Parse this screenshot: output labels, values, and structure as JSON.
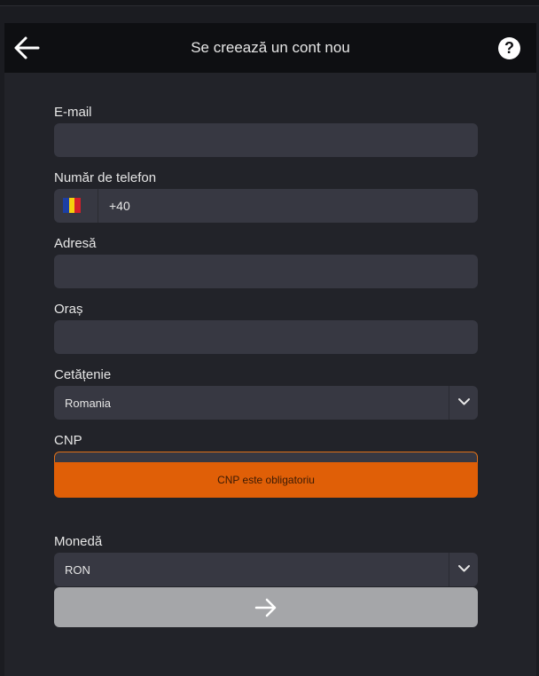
{
  "header": {
    "title": "Se creează un cont nou",
    "help_label": "?"
  },
  "form": {
    "email_label": "E-mail",
    "email_value": "",
    "phone_label": "Număr de telefon",
    "phone_prefix": "+40",
    "phone_flag": "romania-flag",
    "address_label": "Adresă",
    "address_value": "",
    "city_label": "Oraș",
    "city_value": "",
    "citizenship_label": "Cetățenie",
    "citizenship_value": "Romania",
    "cnp_label": "CNP",
    "cnp_value": "",
    "cnp_error": "CNP este obligatoriu",
    "currency_label": "Monedă",
    "currency_value": "RON"
  },
  "colors": {
    "error": "#e05f07",
    "submit_disabled": "#a5a6a9"
  }
}
